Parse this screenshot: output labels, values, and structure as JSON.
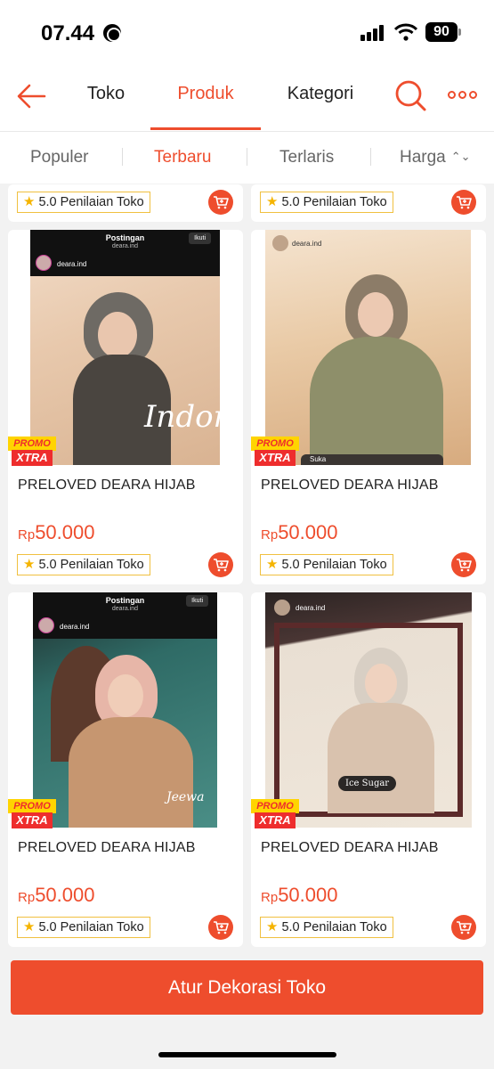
{
  "status": {
    "time": "07.44",
    "battery": "90"
  },
  "header": {
    "tabs": [
      {
        "label": "Toko",
        "active": false
      },
      {
        "label": "Produk",
        "active": true
      },
      {
        "label": "Kategori",
        "active": false
      }
    ]
  },
  "sort": {
    "options": [
      {
        "label": "Populer",
        "active": false
      },
      {
        "label": "Terbaru",
        "active": true
      },
      {
        "label": "Terlaris",
        "active": false
      },
      {
        "label": "Harga",
        "active": false
      }
    ]
  },
  "top_row": [
    {
      "rating": "5.0 Penilaian Toko"
    },
    {
      "rating": "5.0 Penilaian Toko"
    }
  ],
  "products": [
    {
      "name": "PRELOVED DEARA HIJAB",
      "currency": "Rp",
      "price": "50.000",
      "rating": "5.0 Penilaian Toko",
      "promo_top": "PROMO",
      "promo_bottom": "XTRA",
      "ig_title": "Postingan",
      "ig_sub": "deara.ind",
      "ig_user": "deara.ind",
      "ig_follow": "Ikuti",
      "overlay": "Indon"
    },
    {
      "name": "PRELOVED DEARA HIJAB",
      "currency": "Rp",
      "price": "50.000",
      "rating": "5.0 Penilaian Toko",
      "promo_top": "PROMO",
      "promo_bottom": "XTRA",
      "ig_user": "deara.ind",
      "overlay": "Suka"
    },
    {
      "name": "PRELOVED DEARA HIJAB",
      "currency": "Rp",
      "price": "50.000",
      "rating": "5.0 Penilaian Toko",
      "promo_top": "PROMO",
      "promo_bottom": "XTRA",
      "ig_title": "Postingan",
      "ig_sub": "deara.ind",
      "ig_user": "deara.ind",
      "ig_follow": "Ikuti",
      "overlay": "Jeewa"
    },
    {
      "name": "PRELOVED DEARA HIJAB",
      "currency": "Rp",
      "price": "50.000",
      "rating": "5.0 Penilaian Toko",
      "promo_top": "PROMO",
      "promo_bottom": "XTRA",
      "ig_user": "deara.ind",
      "overlay": "Ice Sugar"
    }
  ],
  "cta": {
    "label": "Atur Dekorasi Toko"
  },
  "colors": {
    "accent": "#ee4d2d",
    "rating_border": "#f0c040",
    "star": "#f5b400"
  }
}
